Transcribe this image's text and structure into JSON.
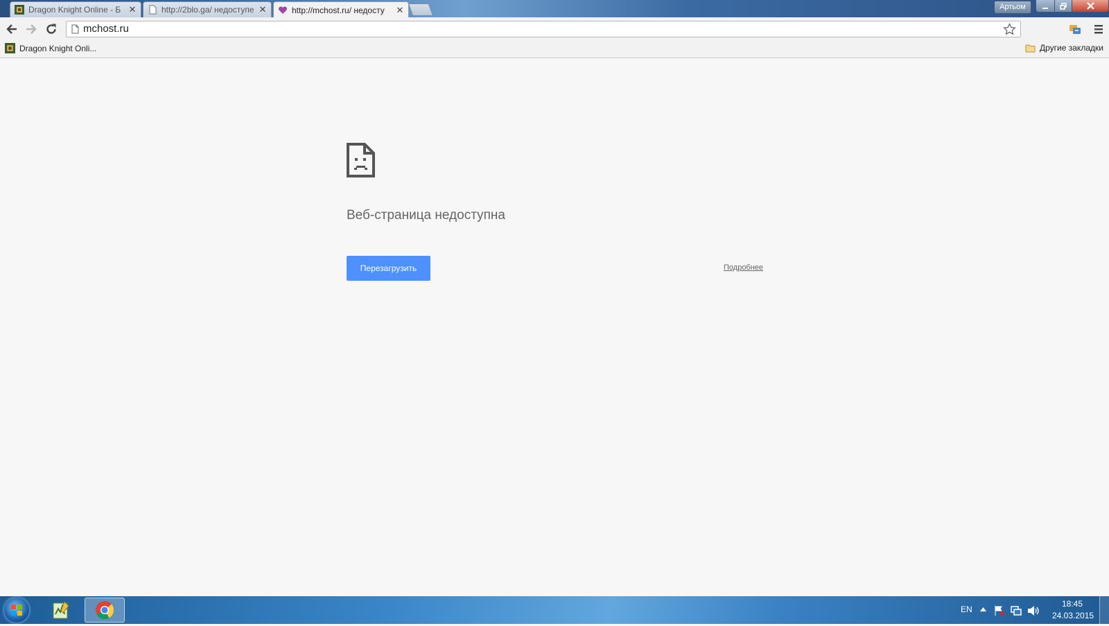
{
  "browser": {
    "tabs": [
      {
        "title": "Dragon Knight Online - Б",
        "active": false
      },
      {
        "title": "http://2blo.ga/ недоступе",
        "active": false
      },
      {
        "title": "http://mchost.ru/ недосту",
        "active": true
      }
    ],
    "tab_close_glyph": "✕",
    "profile_name": "Артьом",
    "address": "mchost.ru",
    "bookmarks": {
      "items": [
        {
          "label": "Dragon Knight Onli..."
        }
      ],
      "other_label": "Другие закладки"
    }
  },
  "error_page": {
    "title": "Веб-страница недоступна",
    "reload_label": "Перезагрузить",
    "details_label": "Подробнее"
  },
  "taskbar": {
    "language": "EN",
    "time": "18:45",
    "date": "24.03.2015"
  },
  "colors": {
    "reload_button": "#4d90fe",
    "page_background": "#f7f7f7"
  }
}
